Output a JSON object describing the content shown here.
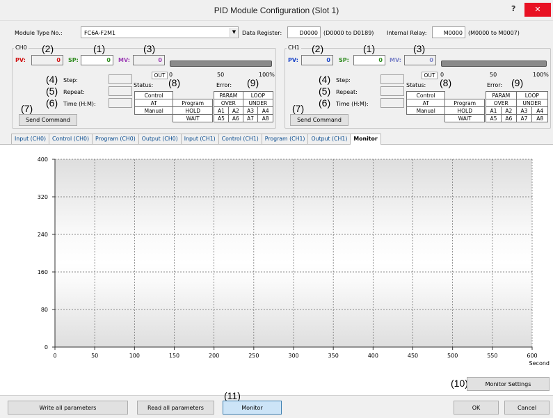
{
  "window": {
    "title": "PID Module Configuration (Slot 1)",
    "help": "?",
    "close": "✕"
  },
  "header": {
    "module_type_label": "Module Type No.:",
    "module_type_value": "FC6A-F2M1",
    "data_register_label": "Data Register:",
    "data_register_value": "D0000",
    "data_register_range": "(D0000 to D0189)",
    "internal_relay_label": "Internal Relay:",
    "internal_relay_value": "M0000",
    "internal_relay_range": "(M0000 to M0007)"
  },
  "colors": {
    "pv": "#d01010",
    "sp": "#2c8a1c",
    "mv": "#9c3cb4",
    "pv_ch1": "#1a44c8",
    "mv_ch1": "#7a82c8"
  },
  "channels": [
    {
      "name": "CH0",
      "pv_label": "PV:",
      "pv_value": "0",
      "sp_label": "SP:",
      "sp_value": "0",
      "mv_label": "MV:",
      "mv_value": "0",
      "out_label": "OUT",
      "scale": [
        "0",
        "50",
        "100%"
      ],
      "step_label": "Step:",
      "repeat_label": "Repeat:",
      "time_label": "Time (H:M):",
      "status_label": "Status:",
      "error_label": "Error:",
      "send_command": "Send Command",
      "status_table": [
        [
          "Control",
          ""
        ],
        [
          "AT",
          "Program"
        ],
        [
          "Manual",
          "HOLD"
        ],
        [
          "",
          "WAIT"
        ]
      ],
      "error_table": {
        "param": "PARAM",
        "loop": "LOOP",
        "over": "OVER",
        "under": "UNDER",
        "cells": [
          [
            "A1",
            "A2",
            "A3",
            "A4"
          ],
          [
            "A5",
            "A6",
            "A7",
            "A8"
          ]
        ]
      }
    },
    {
      "name": "CH1",
      "pv_label": "PV:",
      "pv_value": "0",
      "sp_label": "SP:",
      "sp_value": "0",
      "mv_label": "MV:",
      "mv_value": "0",
      "out_label": "OUT",
      "scale": [
        "0",
        "50",
        "100%"
      ],
      "step_label": "Step:",
      "repeat_label": "Repeat:",
      "time_label": "Time (H:M):",
      "status_label": "Status:",
      "error_label": "Error:",
      "send_command": "Send Command",
      "status_table": [
        [
          "Control",
          ""
        ],
        [
          "AT",
          "Program"
        ],
        [
          "Manual",
          "HOLD"
        ],
        [
          "",
          "WAIT"
        ]
      ],
      "error_table": {
        "param": "PARAM",
        "loop": "LOOP",
        "over": "OVER",
        "under": "UNDER",
        "cells": [
          [
            "A1",
            "A2",
            "A3",
            "A4"
          ],
          [
            "A5",
            "A6",
            "A7",
            "A8"
          ]
        ]
      }
    }
  ],
  "callouts": {
    "n1": "(1)",
    "n2": "(2)",
    "n3": "(3)",
    "n4": "(4)",
    "n5": "(5)",
    "n6": "(6)",
    "n7": "(7)",
    "n8": "(8)",
    "n9": "(9)",
    "n10": "(10)",
    "n11": "(11)"
  },
  "tabs": [
    "Input (CH0)",
    "Control (CH0)",
    "Program (CH0)",
    "Output (CH0)",
    "Input (CH1)",
    "Control (CH1)",
    "Program (CH1)",
    "Output (CH1)",
    "Monitor"
  ],
  "active_tab": "Monitor",
  "chart_data": {
    "type": "line",
    "x_ticks": [
      0,
      50,
      100,
      150,
      200,
      250,
      300,
      350,
      400,
      450,
      500,
      550,
      600
    ],
    "y_ticks": [
      0,
      80,
      160,
      240,
      320,
      400
    ],
    "xlim": [
      0,
      600
    ],
    "ylim": [
      0,
      400
    ],
    "xlabel": "Second",
    "grid": true,
    "series": []
  },
  "monitor_settings": "Monitor Settings",
  "footer": {
    "write_all": "Write all parameters",
    "read_all": "Read all parameters",
    "monitor": "Monitor",
    "ok": "OK",
    "cancel": "Cancel"
  }
}
